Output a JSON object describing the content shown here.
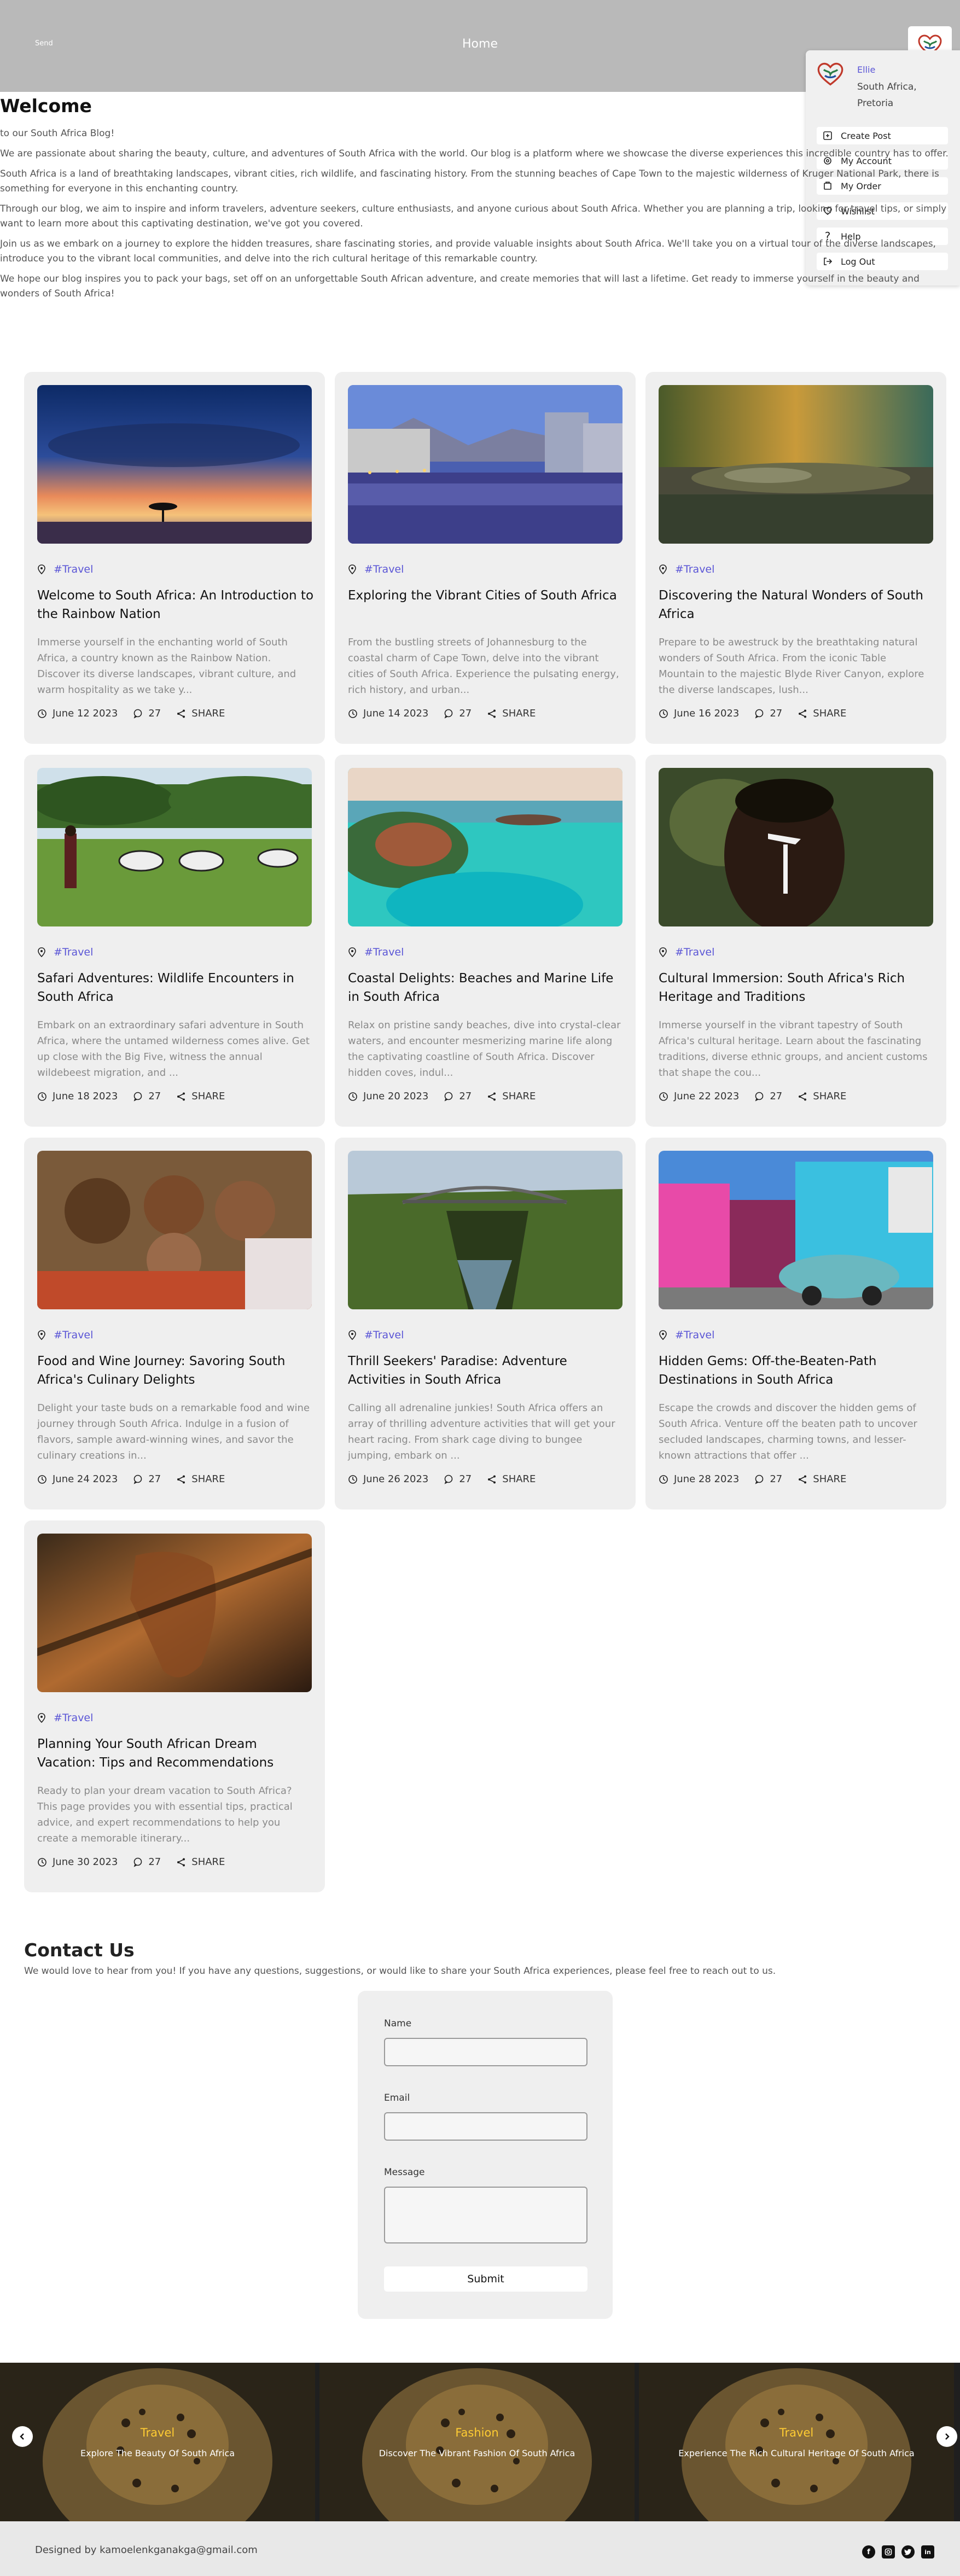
{
  "header": {
    "brand": "Send",
    "nav_home": "Home"
  },
  "profile_menu": {
    "name": "Ellie",
    "location": "South Africa, Pretoria",
    "items": [
      {
        "label": "Create Post",
        "icon": "create-post-icon"
      },
      {
        "label": "My Account",
        "icon": "gear-icon"
      },
      {
        "label": "My Order",
        "icon": "order-icon"
      },
      {
        "label": "Wishlist",
        "icon": "heart-icon"
      },
      {
        "label": "Help",
        "icon": "question-icon"
      },
      {
        "label": "Log Out",
        "icon": "logout-icon"
      }
    ]
  },
  "intro": {
    "title": "Welcome",
    "paragraphs": [
      "to our South Africa Blog!",
      "We are passionate about sharing the beauty, culture, and adventures of South Africa with the world. Our blog is a platform where we showcase the diverse experiences this incredible country has to offer.",
      "South Africa is a land of breathtaking landscapes, vibrant cities, rich wildlife, and fascinating history. From the stunning beaches of Cape Town to the majestic wilderness of Kruger National Park, there is something for everyone in this enchanting country.",
      "Through our blog, we aim to inspire and inform travelers, adventure seekers, culture enthusiasts, and anyone curious about South Africa. Whether you are planning a trip, looking for travel tips, or simply want to learn more about this captivating destination, we've got you covered.",
      "Join us as we embark on a journey to explore the hidden treasures, share fascinating stories, and provide valuable insights about South Africa. We'll take you on a virtual tour of the diverse landscapes, introduce you to the vibrant local communities, and delve into the rich cultural heritage of this remarkable country.",
      "We hope our blog inspires you to pack your bags, set off on an unforgettable South African adventure, and create memories that will last a lifetime. Get ready to immerse yourself in the beauty and wonders of South Africa!"
    ]
  },
  "posts": [
    {
      "tag": "#Travel",
      "title": "Welcome to South Africa: An Introduction to the Rainbow Nation",
      "excerpt": "Immerse yourself in the enchanting world of South Africa, a country known as the Rainbow Nation. Discover its diverse landscapes, vibrant culture, and warm hospitality as we take y...",
      "date": "June 12 2023",
      "comments": "27",
      "share": "SHARE",
      "image": "sunset-acacia"
    },
    {
      "tag": "#Travel",
      "title": "Exploring the Vibrant Cities of South Africa",
      "excerpt": "From the bustling streets of Johannesburg to the coastal charm of Cape Town, delve into the vibrant cities of South Africa. Experience the pulsating energy, rich history, and urban...",
      "date": "June 14 2023",
      "comments": "27",
      "share": "SHARE",
      "image": "city-waterfront"
    },
    {
      "tag": "#Travel",
      "title": "Discovering the Natural Wonders of South Africa",
      "excerpt": "Prepare to be awestruck by the breathtaking natural wonders of South Africa. From the iconic Table Mountain to the majestic Blyde River Canyon, explore the diverse landscapes, lush...",
      "date": "June 16 2023",
      "comments": "27",
      "share": "SHARE",
      "image": "crocodile"
    },
    {
      "tag": "#Travel",
      "title": "Safari Adventures: Wildlife Encounters in South Africa",
      "excerpt": "Embark on an extraordinary safari adventure in South Africa, where the untamed wilderness comes alive. Get up close with the Big Five, witness the annual wildebeest migration, and ...",
      "date": "June 18 2023",
      "comments": "27",
      "share": "SHARE",
      "image": "zebras"
    },
    {
      "tag": "#Travel",
      "title": "Coastal Delights: Beaches and Marine Life in South Africa",
      "excerpt": "Relax on pristine sandy beaches, dive into crystal-clear waters, and encounter mesmerizing marine life along the captivating coastline of South Africa. Discover hidden coves, indul...",
      "date": "June 20 2023",
      "comments": "27",
      "share": "SHARE",
      "image": "island-resort"
    },
    {
      "tag": "#Travel",
      "title": "Cultural Immersion: South Africa's Rich Heritage and Traditions",
      "excerpt": "Immerse yourself in the vibrant tapestry of South Africa's cultural heritage. Learn about the fascinating traditions, diverse ethnic groups, and ancient customs that shape the cou...",
      "date": "June 22 2023",
      "comments": "27",
      "share": "SHARE",
      "image": "painted-face"
    },
    {
      "tag": "#Travel",
      "title": "Food and Wine Journey: Savoring South Africa's Culinary Delights",
      "excerpt": "Delight your taste buds on a remarkable food and wine journey through South Africa. Indulge in a fusion of flavors, sample award-winning wines, and savor the culinary creations in...",
      "date": "June 24 2023",
      "comments": "27",
      "share": "SHARE",
      "image": "family"
    },
    {
      "tag": "#Travel",
      "title": "Thrill Seekers' Paradise: Adventure Activities in South Africa",
      "excerpt": "Calling all adrenaline junkies! South Africa offers an array of thrilling adventure activities that will get your heart racing. From shark cage diving to bungee jumping, embark on ...",
      "date": "June 26 2023",
      "comments": "27",
      "share": "SHARE",
      "image": "bridge-gorge"
    },
    {
      "tag": "#Travel",
      "title": "Hidden Gems: Off-the-Beaten-Path Destinations in South Africa",
      "excerpt": "Escape the crowds and discover the hidden gems of South Africa. Venture off the beaten path to uncover secluded landscapes, charming towns, and lesser-known attractions that offer ...",
      "date": "June 28 2023",
      "comments": "27",
      "share": "SHARE",
      "image": "colorful-houses"
    },
    {
      "tag": "#Travel",
      "title": "Planning Your South African Dream Vacation: Tips and Recommendations",
      "excerpt": "Ready to plan your dream vacation to South Africa? This page provides you with essential tips, practical advice, and expert recommendations to help you create a memorable itinerary...",
      "date": "June 30 2023",
      "comments": "27",
      "share": "SHARE",
      "image": "map-africa"
    }
  ],
  "contact": {
    "title": "Contact Us",
    "subtitle": "We would love to hear from you! If you have any questions, suggestions, or would like to share your South Africa experiences, please feel free to reach out to us.",
    "name_label": "Name",
    "email_label": "Email",
    "message_label": "Message",
    "submit_label": "Submit"
  },
  "carousel": {
    "slides": [
      {
        "label": "Travel",
        "description": "Explore The Beauty Of South Africa"
      },
      {
        "label": "Fashion",
        "description": "Discover The Vibrant Fashion Of South Africa"
      },
      {
        "label": "Travel",
        "description": "Experience The Rich Cultural Heritage Of South Africa"
      }
    ]
  },
  "footer": {
    "credit": "Designed by kamoelenkganakga@gmail.com",
    "socials": [
      "facebook-icon",
      "instagram-icon",
      "twitter-icon",
      "linkedin-icon"
    ]
  }
}
